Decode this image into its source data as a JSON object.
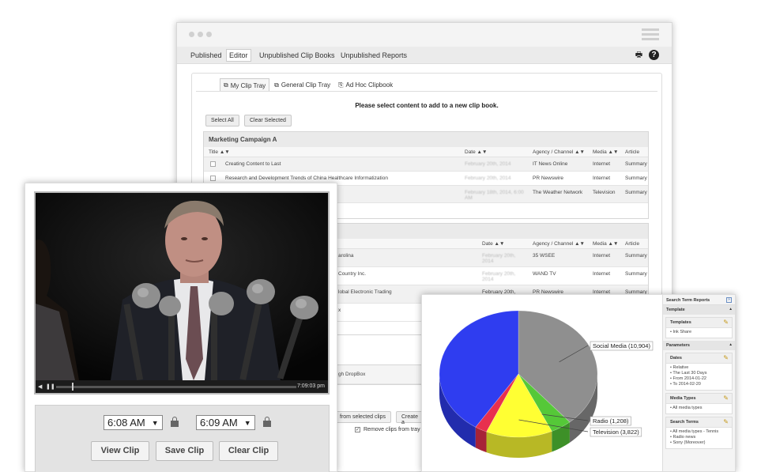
{
  "editor_window": {
    "nav": [
      "Published",
      "Editor",
      "Unpublished Clip Books",
      "Unpublished Reports"
    ],
    "active_nav": "Editor",
    "tabs": [
      "My Clip Tray",
      "General Clip Tray",
      "Ad Hoc Clipbook"
    ],
    "prompt": "Please select content to add to a new clip book.",
    "select_all": "Select All",
    "clear_selected": "Clear Selected",
    "section1": {
      "title": "Marketing Campaign A",
      "columns": [
        "Title ▲▼",
        "Date ▲▼",
        "Agency / Channel ▲▼",
        "Media ▲▼",
        "Article"
      ],
      "rows": [
        {
          "title": "Creating Content to Last",
          "date": "February 20th, 2014",
          "agency": "IT News Online",
          "media": "Internet",
          "article": "Summary"
        },
        {
          "title": "Research and Development Trends of China Healthcare Informatization",
          "date": "February 20th, 2014",
          "agency": "PR Newswire",
          "media": "Internet",
          "article": "Summary"
        },
        {
          "title": "",
          "date": "February 18th, 2014, 6:00 AM",
          "agency": "The Weather Network",
          "media": "Television",
          "article": "Summary"
        }
      ]
    },
    "section2": {
      "columns": [
        "Date ▲▼",
        "Agency / Channel ▲▼",
        "Media ▲▼",
        "Article"
      ],
      "rows": [
        {
          "title": "arolina",
          "date": "February 20th, 2014",
          "agency": "35 WSEE",
          "media": "Internet",
          "article": "Summary"
        },
        {
          "title": "Country Inc.",
          "date": "February 20th, 2014",
          "agency": "WAND TV",
          "media": "Internet",
          "article": "Summary"
        },
        {
          "title": "lobal Electronic Trading",
          "date": "February 20th,",
          "agency": "PR Newswire",
          "media": "Internet",
          "article": "Summary"
        },
        {
          "title": "x",
          "date": "",
          "agency": "",
          "media": "",
          "article": ""
        }
      ]
    },
    "extra_row": "gh DropBox",
    "from_selected": "from selected clips",
    "create": "Create a",
    "remove_option": "Remove clips from tray wh"
  },
  "video_window": {
    "time_display": "7:09:03 pm",
    "start_time": "6:08 AM",
    "end_time": "6:09 AM",
    "view_clip": "View Clip",
    "save_clip": "Save Clip",
    "clear_clip": "Clear Clip"
  },
  "report_window": {
    "sidebar_title": "Search Term Reports",
    "template_section": "Template",
    "templates_card": "Templates",
    "templates_items": [
      "Ink Share"
    ],
    "parameters_section": "Parameters",
    "dates_card": "Dates",
    "dates_items": [
      "Relative",
      "The Last 30 Days",
      "From 2014-01-22",
      "To 2014-02-20"
    ],
    "media_card": "Media Types",
    "media_items": [
      "All media types"
    ],
    "search_card": "Search Terms",
    "search_items": [
      "All media types - Tennis",
      "Radio news",
      "Sony (Moreover)"
    ]
  },
  "chart_data": {
    "type": "pie",
    "slices": [
      {
        "label": "Social Media (10,904)",
        "value": 10904,
        "color": "#8f8f8f"
      },
      {
        "label": "Radio (1,208)",
        "value": 1208,
        "color": "#55c838"
      },
      {
        "label": "Television (3,822)",
        "value": 3822,
        "color": "#ffff33"
      },
      {
        "label": "",
        "value": 700,
        "color": "#e8304e"
      },
      {
        "label": "",
        "value": 11500,
        "color": "#2f3df0"
      }
    ]
  }
}
